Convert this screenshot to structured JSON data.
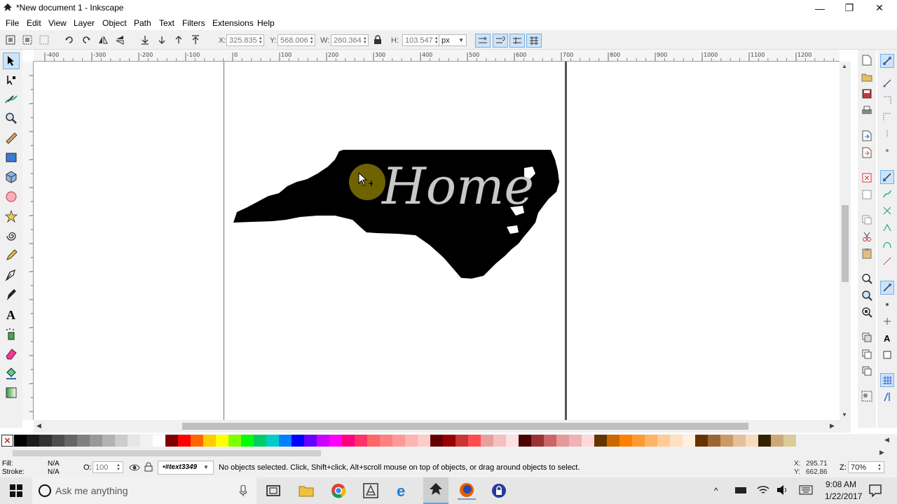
{
  "window": {
    "title": "*New document 1 - Inkscape",
    "minimize": "—",
    "restore": "❐",
    "close": "✕"
  },
  "menu": [
    "File",
    "Edit",
    "View",
    "Object",
    "Layer",
    "Object",
    "Path",
    "Text",
    "Filters",
    "Extensions",
    "Help"
  ],
  "menu_items": {
    "file": "File",
    "edit": "Edit",
    "view": "View",
    "layer": "Layer",
    "object": "Object",
    "path": "Path",
    "text": "Text",
    "filters": "Filters",
    "extensions": "Extensions",
    "help": "Help"
  },
  "toolbar": {
    "x_label": "X:",
    "x_value": "325.835",
    "y_label": "Y:",
    "y_value": "568.006",
    "w_label": "W:",
    "w_value": "260.364",
    "h_label": "H:",
    "h_value": "103.547",
    "unit": "px"
  },
  "ruler_ticks": [
    "-400",
    "-300",
    "-200",
    "-100",
    "0",
    "100",
    "200",
    "300",
    "400",
    "500",
    "600",
    "700",
    "800",
    "900",
    "1000",
    "1100",
    "1200"
  ],
  "canvas": {
    "artwork_text": "Home",
    "shape_fill": "#000000",
    "text_fill": "#c8c8c8",
    "cursor_highlight": "#c8b400"
  },
  "palette": {
    "none_symbol": "✕",
    "colors": [
      "#000000",
      "#1a1a1a",
      "#333333",
      "#4d4d4d",
      "#666666",
      "#808080",
      "#999999",
      "#b3b3b3",
      "#cccccc",
      "#e6e6e6",
      "#f2f2f2",
      "#ffffff",
      "#800000",
      "#ff0000",
      "#ff6600",
      "#ffcc00",
      "#ffff00",
      "#80ff00",
      "#00ff00",
      "#00cc66",
      "#00cccc",
      "#0080ff",
      "#0000ff",
      "#6600ff",
      "#cc00ff",
      "#ff00ff",
      "#ff0080",
      "#ff3366",
      "#ff6666",
      "#ff8080",
      "#ff9999",
      "#ffb3b3",
      "#ffcccc",
      "#660000",
      "#990000",
      "#cc3333",
      "#ff4d4d",
      "#e6a0a0",
      "#f5c0c0",
      "#fde0e0",
      "#4d0000",
      "#993333",
      "#cc6666",
      "#e69999",
      "#f0b3b3",
      "#ffd9d9",
      "#663300",
      "#cc6600",
      "#ff8000",
      "#ff9933",
      "#ffb366",
      "#ffcc99",
      "#ffe0c0",
      "#fff0e0",
      "#663300",
      "#996633",
      "#cc9966",
      "#e6c09a",
      "#f5dcc0",
      "#332200",
      "#ccaa77",
      "#ddcc99"
    ]
  },
  "status": {
    "fill_label": "Fill:",
    "fill_value": "N/A",
    "stroke_label": "Stroke:",
    "stroke_value": "N/A",
    "opacity_label": "O:",
    "opacity_value": "100",
    "layer": "•#text3349",
    "message": "No objects selected. Click, Shift+click, Alt+scroll mouse on top of objects, or drag around objects to select.",
    "cursor_x_label": "X:",
    "cursor_x": "295.71",
    "cursor_y_label": "Y:",
    "cursor_y": "662.86",
    "zoom_label": "Z:",
    "zoom_value": "70%"
  },
  "taskbar": {
    "search_placeholder": "Ask me anything",
    "time": "9:08 AM",
    "date": "1/22/2017"
  }
}
